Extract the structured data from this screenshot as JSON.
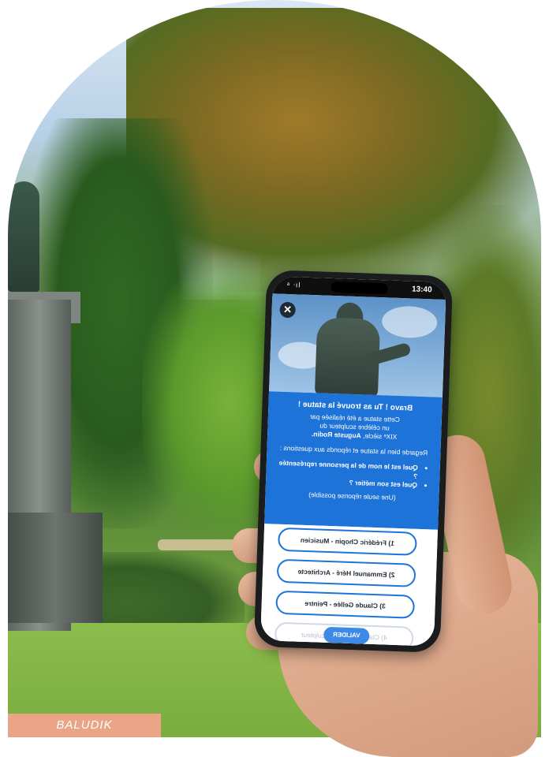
{
  "phone": {
    "status": {
      "time": "13:40",
      "signal": "ᵃ ᐧıl"
    },
    "close_symbol": "✕",
    "info": {
      "title": "Bravo ! Tu as trouvé la statue !",
      "line1": "Cette statue a été réalisée par",
      "line2": "un célèbre sculpteur du",
      "line3_prefix": "XIXᵉ siècle, ",
      "line3_name": "Auguste Rodin.",
      "instruction": "Regarde bien la statue et réponds aux questions :",
      "questions": [
        "Quel est le nom de la personne représentée ?",
        "Quel est son métier ?"
      ],
      "note": "(Une seule réponse possible)"
    },
    "answers": [
      "1) Frédéric Chopin - Musicien",
      "2) Emmanuel Héré - Architecte",
      "3) Claude Gellée - Peintre",
      "4) Claude Lorrain - Sculpteur"
    ],
    "validate_label": "VALIDER"
  },
  "credit": "BALUDIK",
  "colors": {
    "accent": "#1e73d9",
    "credit_bg": "#e9a585"
  }
}
